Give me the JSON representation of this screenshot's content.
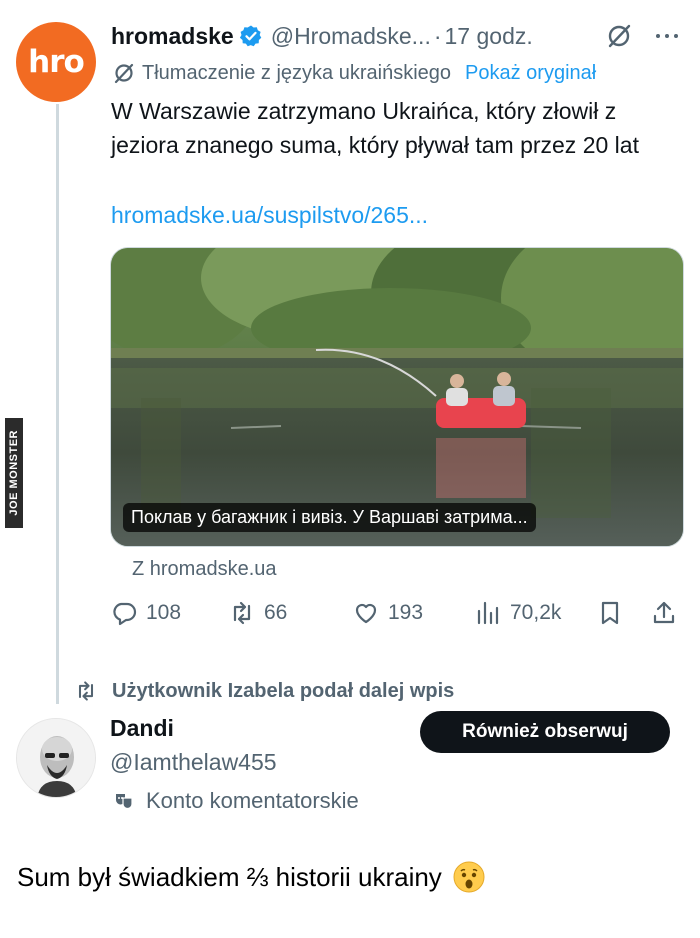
{
  "tweet": {
    "avatar_text": "hro",
    "author_name": "hromadske",
    "handle": "@Hromadske...",
    "time": "17 godz.",
    "translation_note": "Tłumaczenie z języka ukraińskiego",
    "show_original": "Pokaż oryginał",
    "text": "W Warszawie zatrzymano Ukraińca, który złowił z jeziora znanego suma, który pływał tam przez 20 lat",
    "link": "hromadske.ua/suspilstvo/265...",
    "media_caption": "Поклав у багажник і вивіз. У Варшаві затрима...",
    "source": "Z hromadske.ua",
    "stats": {
      "replies": "108",
      "retweets": "66",
      "likes": "193",
      "views": "70,2k"
    },
    "colors": {
      "accent": "#1d9bf0",
      "avatar_bg": "#f26b22",
      "muted": "#536471"
    }
  },
  "repost": {
    "label": "Użytkownik Izabela podał dalej wpis"
  },
  "comment_author": {
    "name": "Dandi",
    "handle": "@Iamthelaw455",
    "follow_label": "Również obserwuj",
    "account_type": "Konto komentatorskie"
  },
  "watermark": "JOE MONSTER",
  "comment": {
    "text": "Sum był świadkiem ⅔ historii ukrainy",
    "emoji": "astonished-face-icon"
  }
}
